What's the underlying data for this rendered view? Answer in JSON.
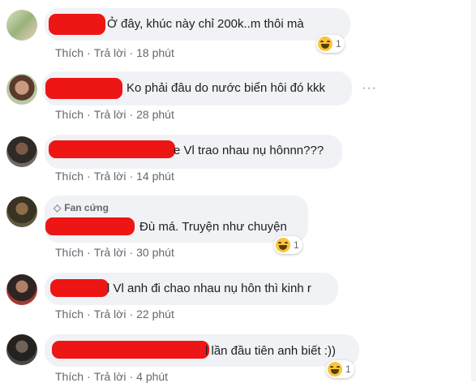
{
  "actions": {
    "like": "Thích",
    "reply": "Trả lời",
    "sep": "·"
  },
  "reaction_icon": "haha-emoji",
  "badge_icon": "diamond-icon",
  "comments": [
    {
      "text": "Ở đây, khúc này chỉ 200k..m thôi mà",
      "time": "18 phút",
      "reaction_count": "1"
    },
    {
      "text": "Ko phải đâu do nước biển hôi đó kkk",
      "time": "28 phút",
      "more": "···"
    },
    {
      "text": "e Vl trao nhau nụ hônnn???",
      "time": "14 phút"
    },
    {
      "badge": "Fan cứng",
      "text": "Đù má. Truyện như chuyện",
      "time": "30 phút",
      "reaction_count": "1"
    },
    {
      "text": "l Vl anh đi chao nhau nụ hôn thì kinh r",
      "time": "22 phút"
    },
    {
      "text": "l lần đầu tiên anh biết :))",
      "time": "4 phút",
      "reaction_count": "1"
    }
  ]
}
